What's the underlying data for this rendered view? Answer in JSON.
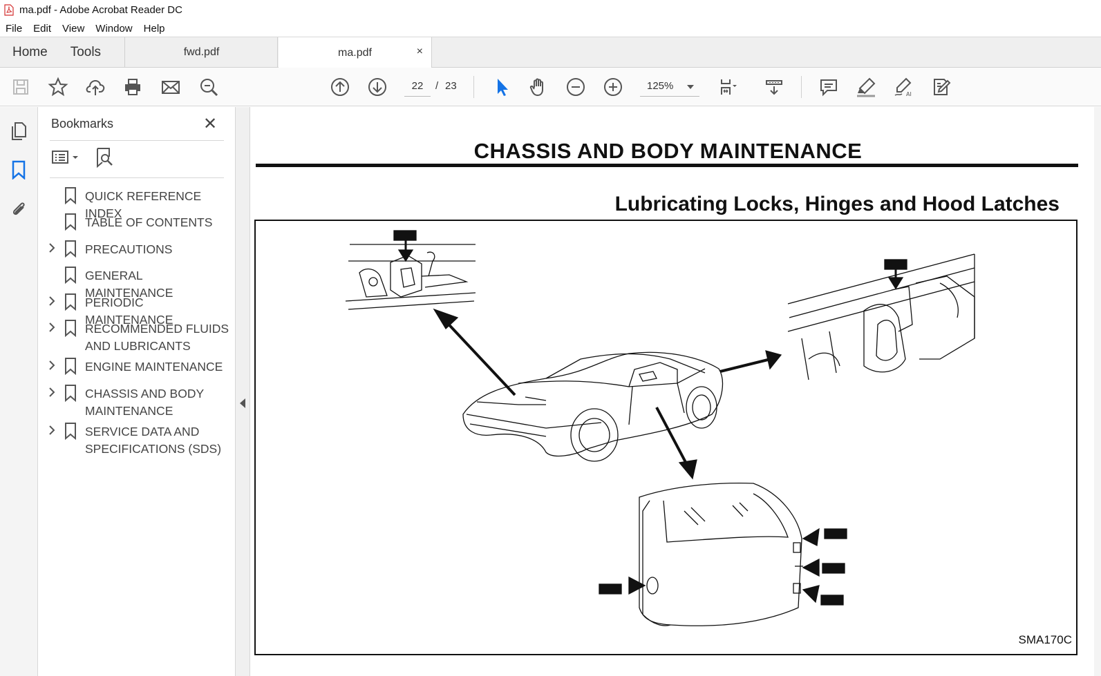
{
  "window": {
    "title": "ma.pdf - Adobe Acrobat Reader DC"
  },
  "menu": [
    "File",
    "Edit",
    "View",
    "Window",
    "Help"
  ],
  "tabs": {
    "home": "Home",
    "tools": "Tools",
    "doc1": "fwd.pdf",
    "doc2": "ma.pdf",
    "close": "×"
  },
  "toolbar": {
    "page_current": "22",
    "page_sep": "/",
    "page_total": "23",
    "zoom": "125%"
  },
  "bookmarks": {
    "header": "Bookmarks",
    "close": "✕",
    "items": [
      {
        "label": "QUICK REFERENCE INDEX",
        "expandable": false
      },
      {
        "label": "TABLE OF CONTENTS",
        "expandable": false
      },
      {
        "label": "PRECAUTIONS",
        "expandable": true
      },
      {
        "label": "GENERAL MAINTENANCE",
        "expandable": false
      },
      {
        "label": "PERIODIC MAINTENANCE",
        "expandable": true
      },
      {
        "label": "RECOMMENDED FLUIDS AND LUBRICANTS",
        "expandable": true
      },
      {
        "label": "ENGINE MAINTENANCE",
        "expandable": true
      },
      {
        "label": "CHASSIS AND BODY MAINTENANCE",
        "expandable": true
      },
      {
        "label": "SERVICE DATA AND SPECIFICATIONS (SDS)",
        "expandable": true
      }
    ]
  },
  "document": {
    "title": "CHASSIS AND BODY MAINTENANCE",
    "subtitle": "Lubricating Locks, Hinges and Hood Latches",
    "figure_id": "SMA170C"
  },
  "colors": {
    "accent": "#1473e6",
    "tab_bg": "#efefef"
  }
}
